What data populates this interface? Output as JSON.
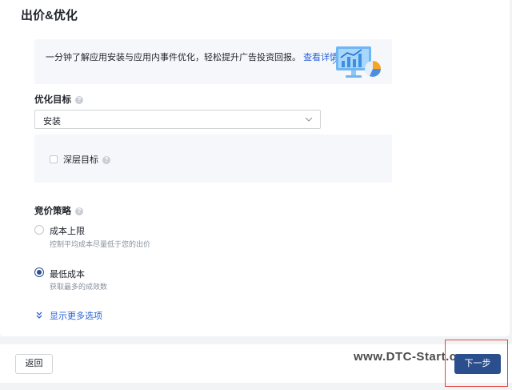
{
  "section_title": "出价&优化",
  "banner": {
    "text": "一分钟了解应用安装与应用内事件优化，轻松提升广告投资回报。",
    "link": "查看详情"
  },
  "optimization_goal": {
    "label": "优化目标",
    "selected": "安装",
    "deep_goal_label": "深层目标",
    "deep_goal_checked": false
  },
  "bid_strategy": {
    "label": "竞价策略",
    "options": [
      {
        "title": "成本上限",
        "desc": "控制平均成本尽量低于您的出价",
        "selected": false
      },
      {
        "title": "最低成本",
        "desc": "获取最多的成效数",
        "selected": true
      }
    ]
  },
  "show_more": "显示更多选项",
  "footer": {
    "back": "返回",
    "next": "下一步",
    "watermark": "www.DTC-Start.com"
  },
  "colors": {
    "primary": "#2b4f8c",
    "link": "#2b63d9",
    "highlight_border": "#e5443c"
  }
}
